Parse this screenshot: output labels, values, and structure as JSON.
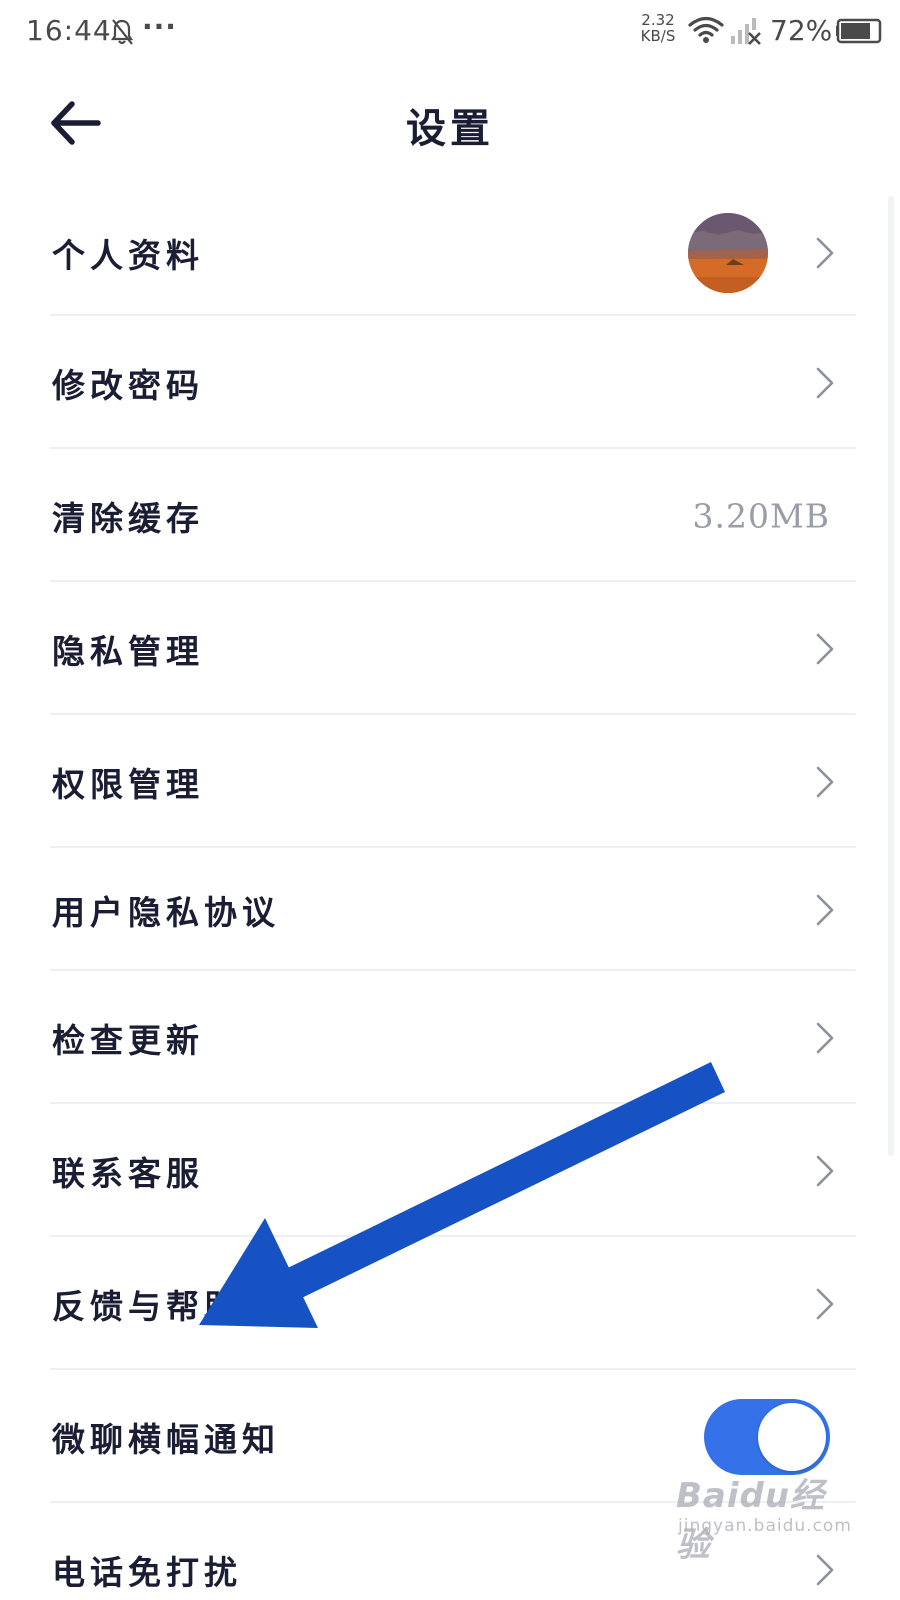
{
  "status_bar": {
    "time": "16:44",
    "more": "···",
    "net_speed_value": "2.32",
    "net_speed_unit": "KB/S",
    "battery_percent": "72%",
    "icons": [
      "bell-muted-icon",
      "wifi-icon",
      "signal-off-icon",
      "battery-icon"
    ]
  },
  "header": {
    "title": "设置",
    "back_icon": "arrow-left-icon"
  },
  "settings": {
    "items": [
      {
        "label": "个人资料",
        "kind": "avatar",
        "icon": "chevron-right-icon"
      },
      {
        "label": "修改密码",
        "kind": "link",
        "icon": "chevron-right-icon"
      },
      {
        "label": "清除缓存",
        "kind": "value",
        "value": "3.20MB"
      },
      {
        "label": "隐私管理",
        "kind": "link",
        "icon": "chevron-right-icon"
      },
      {
        "label": "权限管理",
        "kind": "link",
        "icon": "chevron-right-icon"
      },
      {
        "label": "用户隐私协议",
        "kind": "link",
        "icon": "chevron-right-icon"
      },
      {
        "label": "检查更新",
        "kind": "link",
        "icon": "chevron-right-icon"
      },
      {
        "label": "联系客服",
        "kind": "link",
        "icon": "chevron-right-icon"
      },
      {
        "label": "反馈与帮助",
        "kind": "link",
        "icon": "chevron-right-icon"
      },
      {
        "label": "微聊横幅通知",
        "kind": "toggle",
        "toggle_on": true
      },
      {
        "label": "电话免打扰",
        "kind": "link",
        "icon": "chevron-right-icon"
      }
    ]
  },
  "watermark": {
    "logo_text": "Baidu经验",
    "url": "jingyan.baidu.com"
  },
  "colors": {
    "text_primary": "#1a1d33",
    "text_secondary": "#9a9ca6",
    "toggle_on": "#3571e8",
    "annotation_arrow": "#1652c4",
    "divider": "#eeeff2"
  }
}
